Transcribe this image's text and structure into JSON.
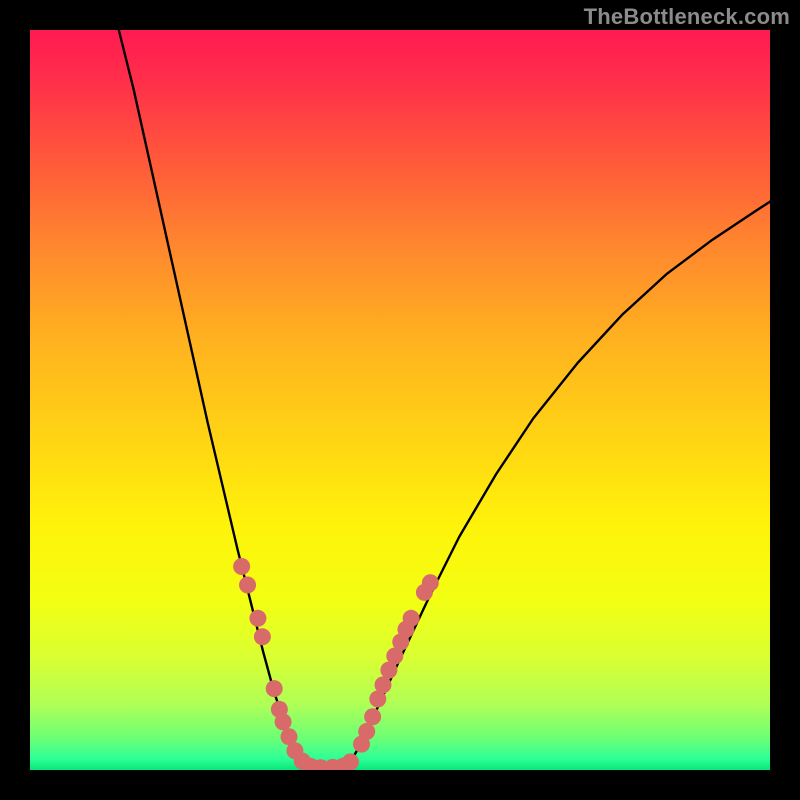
{
  "watermark": "TheBottleneck.com",
  "chart_data": {
    "type": "line",
    "title": "",
    "xlabel": "",
    "ylabel": "",
    "xlim": [
      0,
      100
    ],
    "ylim": [
      0,
      100
    ],
    "background_gradient": {
      "stops": [
        {
          "offset": 0.0,
          "color": "#ff1a52"
        },
        {
          "offset": 0.07,
          "color": "#ff2f4a"
        },
        {
          "offset": 0.18,
          "color": "#ff5a3a"
        },
        {
          "offset": 0.3,
          "color": "#ff8a2d"
        },
        {
          "offset": 0.42,
          "color": "#ffb21f"
        },
        {
          "offset": 0.55,
          "color": "#ffd414"
        },
        {
          "offset": 0.67,
          "color": "#fff30a"
        },
        {
          "offset": 0.77,
          "color": "#f2ff12"
        },
        {
          "offset": 0.85,
          "color": "#d9ff33"
        },
        {
          "offset": 0.91,
          "color": "#b0ff55"
        },
        {
          "offset": 0.955,
          "color": "#70ff74"
        },
        {
          "offset": 0.985,
          "color": "#2dff95"
        },
        {
          "offset": 1.0,
          "color": "#08e67a"
        }
      ]
    },
    "series": [
      {
        "name": "bottleneck-curve-left",
        "stroke": "#000000",
        "x": [
          12.0,
          14.0,
          16.0,
          18.0,
          20.0,
          22.0,
          24.0,
          26.0,
          28.0,
          30.0,
          31.5,
          33.0,
          34.5,
          36.0,
          37.0
        ],
        "y": [
          100.0,
          92.0,
          83.0,
          74.0,
          65.0,
          56.0,
          47.0,
          38.5,
          30.0,
          22.0,
          16.0,
          10.5,
          6.0,
          2.5,
          0.6
        ]
      },
      {
        "name": "bottleneck-curve-flat",
        "stroke": "#000000",
        "x": [
          37.0,
          38.0,
          39.0,
          40.0,
          41.0,
          42.0,
          43.0
        ],
        "y": [
          0.6,
          0.4,
          0.3,
          0.3,
          0.3,
          0.4,
          0.6
        ]
      },
      {
        "name": "bottleneck-curve-right",
        "stroke": "#000000",
        "x": [
          43.0,
          45.0,
          47.0,
          50.0,
          54.0,
          58.0,
          63.0,
          68.0,
          74.0,
          80.0,
          86.0,
          92.0,
          98.0,
          100.0
        ],
        "y": [
          0.6,
          4.0,
          8.5,
          15.0,
          23.5,
          31.5,
          40.0,
          47.5,
          55.0,
          61.5,
          67.0,
          71.5,
          75.5,
          76.8
        ]
      }
    ],
    "markers": {
      "name": "data-points",
      "color": "#d86a6a",
      "r": 8.5,
      "points": [
        {
          "x": 28.6,
          "y": 27.5
        },
        {
          "x": 29.4,
          "y": 25.0
        },
        {
          "x": 30.8,
          "y": 20.5
        },
        {
          "x": 31.4,
          "y": 18.0
        },
        {
          "x": 33.0,
          "y": 11.0
        },
        {
          "x": 33.7,
          "y": 8.2
        },
        {
          "x": 34.2,
          "y": 6.5
        },
        {
          "x": 35.0,
          "y": 4.5
        },
        {
          "x": 35.8,
          "y": 2.6
        },
        {
          "x": 36.8,
          "y": 1.2
        },
        {
          "x": 37.9,
          "y": 0.5
        },
        {
          "x": 39.3,
          "y": 0.3
        },
        {
          "x": 40.9,
          "y": 0.35
        },
        {
          "x": 42.3,
          "y": 0.5
        },
        {
          "x": 43.3,
          "y": 1.1
        },
        {
          "x": 44.8,
          "y": 3.5
        },
        {
          "x": 45.5,
          "y": 5.2
        },
        {
          "x": 46.3,
          "y": 7.2
        },
        {
          "x": 47.0,
          "y": 9.6
        },
        {
          "x": 47.7,
          "y": 11.5
        },
        {
          "x": 48.5,
          "y": 13.5
        },
        {
          "x": 49.3,
          "y": 15.4
        },
        {
          "x": 50.1,
          "y": 17.3
        },
        {
          "x": 50.8,
          "y": 19.0
        },
        {
          "x": 51.5,
          "y": 20.5
        },
        {
          "x": 53.3,
          "y": 24.0
        },
        {
          "x": 54.1,
          "y": 25.3
        }
      ]
    }
  }
}
